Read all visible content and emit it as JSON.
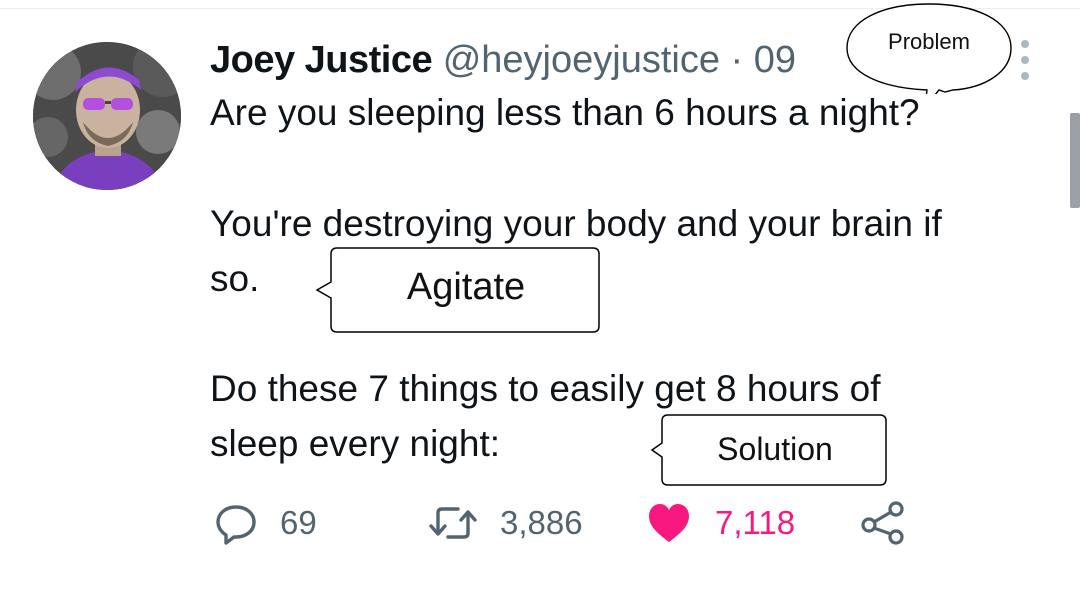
{
  "tweet": {
    "author_name": "Joey Justice",
    "handle_time": "@heyjoeyjustice · 09",
    "lines": [
      "Are you sleeping less than 6 hours a night?",
      "You're destroying your body and your brain if",
      "so.",
      "Do these 7 things to easily get 8 hours of",
      "sleep every night:"
    ]
  },
  "annotations": {
    "problem": "Problem",
    "agitate": "Agitate",
    "solution": "Solution"
  },
  "actions": {
    "replies": "69",
    "retweets": "3,886",
    "likes": "7,118"
  },
  "icons": [
    "more-icon",
    "reply-icon",
    "retweet-icon",
    "like-icon",
    "share-icon"
  ],
  "colors": {
    "like": "#f91880",
    "muted": "#536471",
    "text": "#0f1419"
  }
}
